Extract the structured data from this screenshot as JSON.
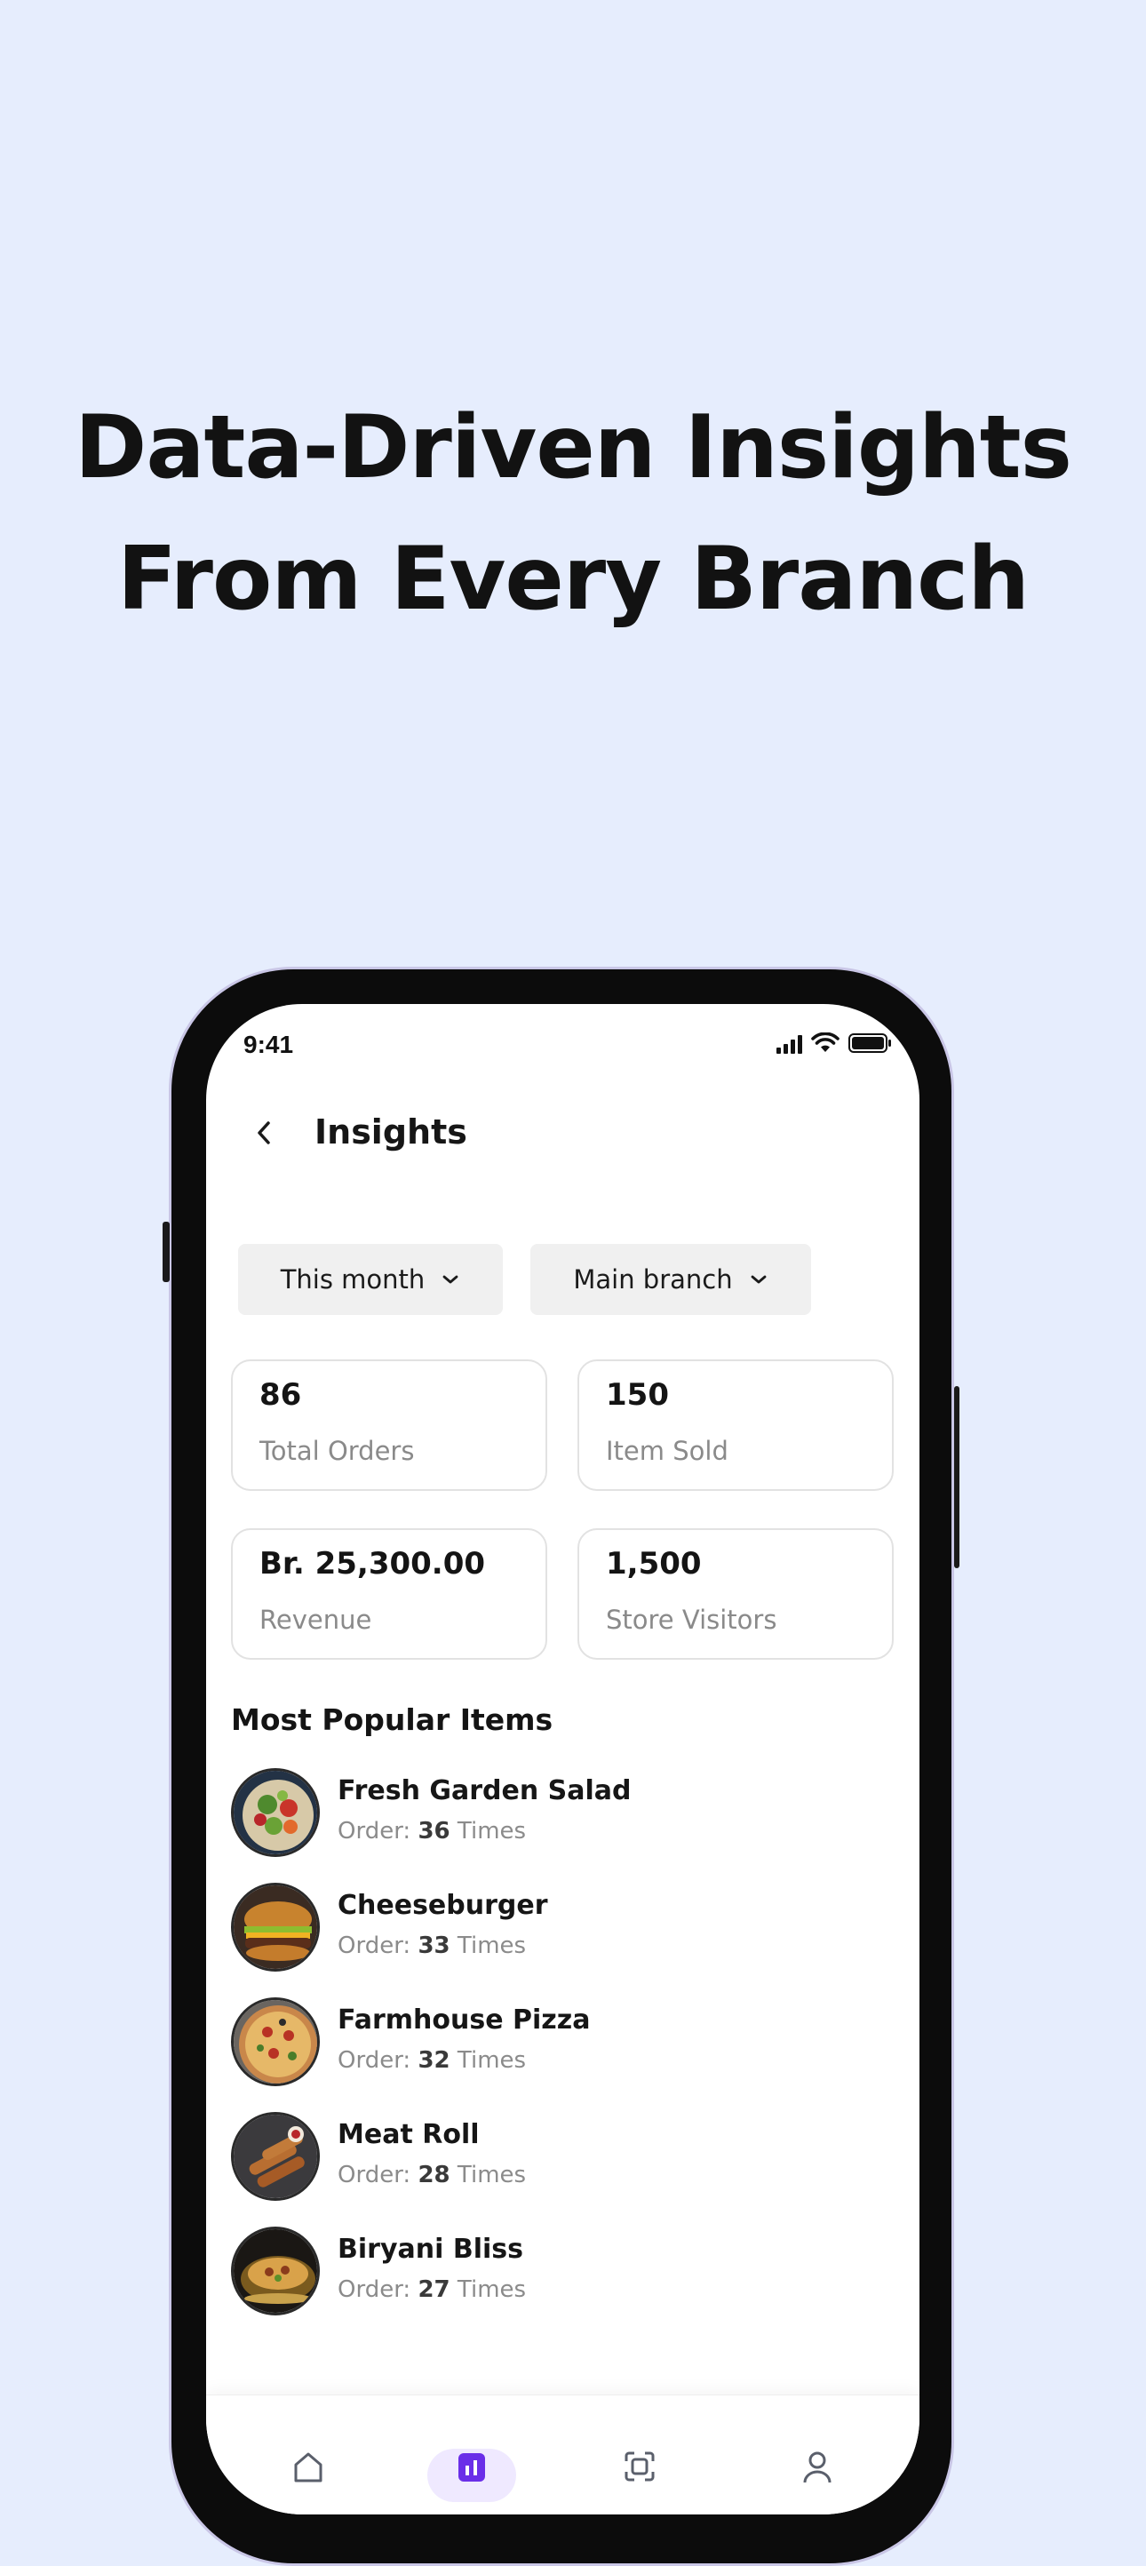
{
  "headline": {
    "line1": "Data-Driven Insights",
    "line2": "From Every Branch"
  },
  "status_bar": {
    "time": "9:41"
  },
  "header": {
    "title": "Insights",
    "back_icon": "chevron-left-icon"
  },
  "filters": [
    {
      "label": "This month",
      "icon": "chevron-down-icon"
    },
    {
      "label": "Main branch",
      "icon": "chevron-down-icon"
    }
  ],
  "stats": [
    {
      "value": "86",
      "label": "Total Orders"
    },
    {
      "value": "150",
      "label": "Item Sold"
    },
    {
      "value": "Br. 25,300.00",
      "label": "Revenue"
    },
    {
      "value": "1,500",
      "label": "Store Visitors"
    }
  ],
  "popular": {
    "title": "Most Popular  Items",
    "order_prefix": "Order:",
    "order_suffix": "Times",
    "items": [
      {
        "name": "Fresh Garden Salad",
        "count": "36"
      },
      {
        "name": "Cheeseburger",
        "count": "33"
      },
      {
        "name": "Farmhouse Pizza",
        "count": "32"
      },
      {
        "name": "Meat Roll",
        "count": "28"
      },
      {
        "name": "Biryani Bliss",
        "count": "27"
      }
    ]
  },
  "bottom_nav": {
    "items": [
      "home-icon",
      "insights-icon",
      "scan-icon",
      "profile-icon"
    ],
    "active": "insights-icon"
  },
  "colors": {
    "background": "#e6edfd",
    "accent": "#6a2ee8",
    "accent_soft": "#efe9ff"
  }
}
